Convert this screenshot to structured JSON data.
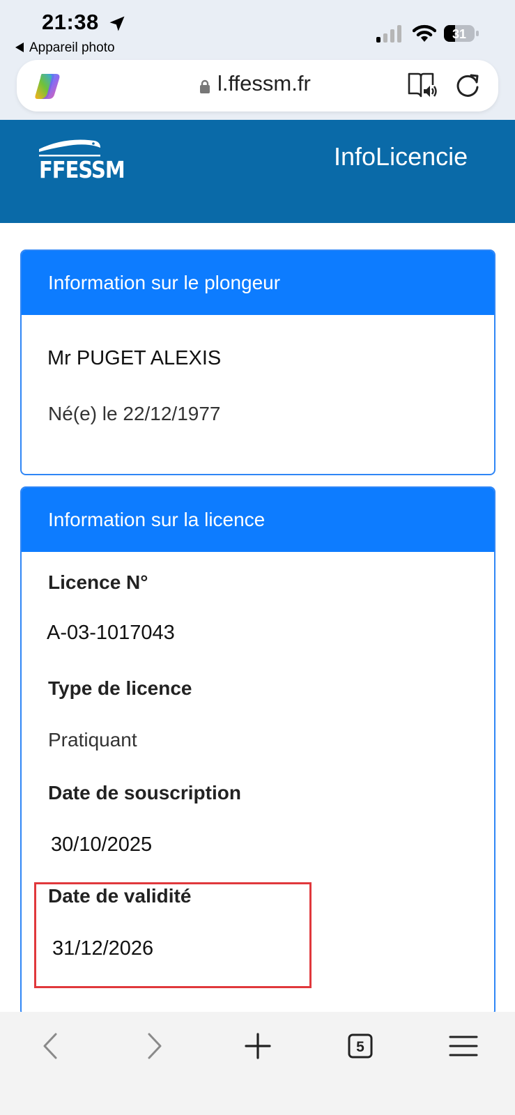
{
  "status_bar": {
    "time": "21:38",
    "back_app": "Appareil photo",
    "battery": "31"
  },
  "browser": {
    "url": "l.ffessm.fr",
    "tab_count": "5"
  },
  "header": {
    "logo_text": "FFESSM",
    "title": "InfoLicencie"
  },
  "diver_card": {
    "header": "Information sur le plongeur",
    "name": "Mr PUGET ALEXIS",
    "birth": "Né(e) le 22/12/1977"
  },
  "licence_card": {
    "header": "Information sur la licence",
    "fields": [
      {
        "label": "Licence N°",
        "value": "A-03-1017043"
      },
      {
        "label": "Type de licence",
        "value": "Pratiquant"
      },
      {
        "label": "Date de souscription",
        "value": "30/10/2025"
      },
      {
        "label": "Date de validité",
        "value": "31/12/2026"
      }
    ]
  },
  "colors": {
    "header_bg": "#0a6aa8",
    "card_header": "#0d7cff",
    "card_border": "#2f86f6",
    "highlight": "#e0383c"
  }
}
